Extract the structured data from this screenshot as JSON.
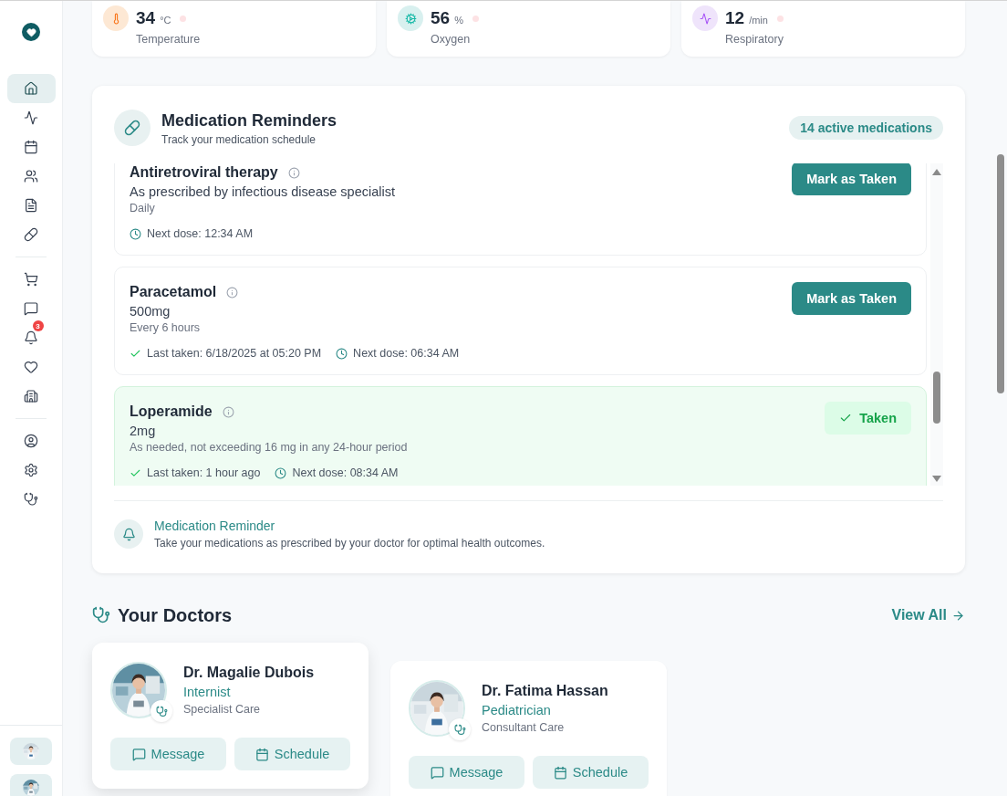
{
  "sidebar": {
    "groups": [
      [
        {
          "kind": "home",
          "selected": true
        },
        {
          "kind": "activity",
          "selected": false
        },
        {
          "kind": "calendar",
          "selected": false
        },
        {
          "kind": "users",
          "selected": false
        },
        {
          "kind": "file",
          "selected": false
        },
        {
          "kind": "pill",
          "selected": false
        }
      ],
      [
        {
          "kind": "cart",
          "selected": false
        },
        {
          "kind": "message",
          "selected": false
        },
        {
          "kind": "bell",
          "selected": false,
          "badge": "3"
        },
        {
          "kind": "heart",
          "selected": false
        },
        {
          "kind": "building",
          "selected": false
        }
      ],
      [
        {
          "kind": "user",
          "selected": false
        },
        {
          "kind": "settings",
          "selected": false
        },
        {
          "kind": "stethoscope",
          "selected": false
        }
      ]
    ],
    "avatars": [
      {
        "kind": "picture"
      },
      {
        "kind": "picture"
      }
    ]
  },
  "vitals": [
    {
      "kind": "temperature",
      "value": "34",
      "unit": "°C",
      "label": "Temperature"
    },
    {
      "kind": "oxygen",
      "value": "56",
      "unit": "%",
      "label": "Oxygen"
    },
    {
      "kind": "respiratory",
      "value": "12",
      "unit": "/min",
      "label": "Respiratory"
    }
  ],
  "medications": {
    "title": "Medication Reminders",
    "subtitle": "Track your medication schedule",
    "badge": "14 active medications",
    "items": [
      {
        "name": "Antiretroviral therapy",
        "dose": "As prescribed by infectious disease specialist",
        "frequency": "Daily",
        "next_dose": "Next dose: 12:34 AM",
        "taken": false,
        "action": "Mark as Taken"
      },
      {
        "name": "Paracetamol",
        "dose": "500mg",
        "frequency": "Every 6 hours",
        "last_taken": "Last taken: 6/18/2025 at 05:20 PM",
        "next_dose": "Next dose: 06:34 AM",
        "taken": false,
        "action": "Mark as Taken"
      },
      {
        "name": "Loperamide",
        "dose": "2mg",
        "frequency": "As needed, not exceeding 16 mg in any 24-hour period",
        "last_taken": "Last taken: 1 hour ago",
        "next_dose": "Next dose: 08:34 AM",
        "taken": true,
        "action": "Taken"
      }
    ],
    "reminder": {
      "title": "Medication Reminder",
      "text": "Take your medications as prescribed by your doctor for optimal health outcomes."
    }
  },
  "doctors": {
    "title": "Your Doctors",
    "view_all": "View All",
    "items": [
      {
        "name": "Dr. Magalie Dubois",
        "specialty": "Internist",
        "care": "Specialist Care",
        "hovered": true,
        "actions": [
          "Message",
          "Schedule"
        ]
      },
      {
        "name": "Dr. Fatima Hassan",
        "specialty": "Pediatrician",
        "care": "Consultant Care",
        "hovered": false,
        "actions": [
          "Message",
          "Schedule"
        ]
      }
    ]
  }
}
